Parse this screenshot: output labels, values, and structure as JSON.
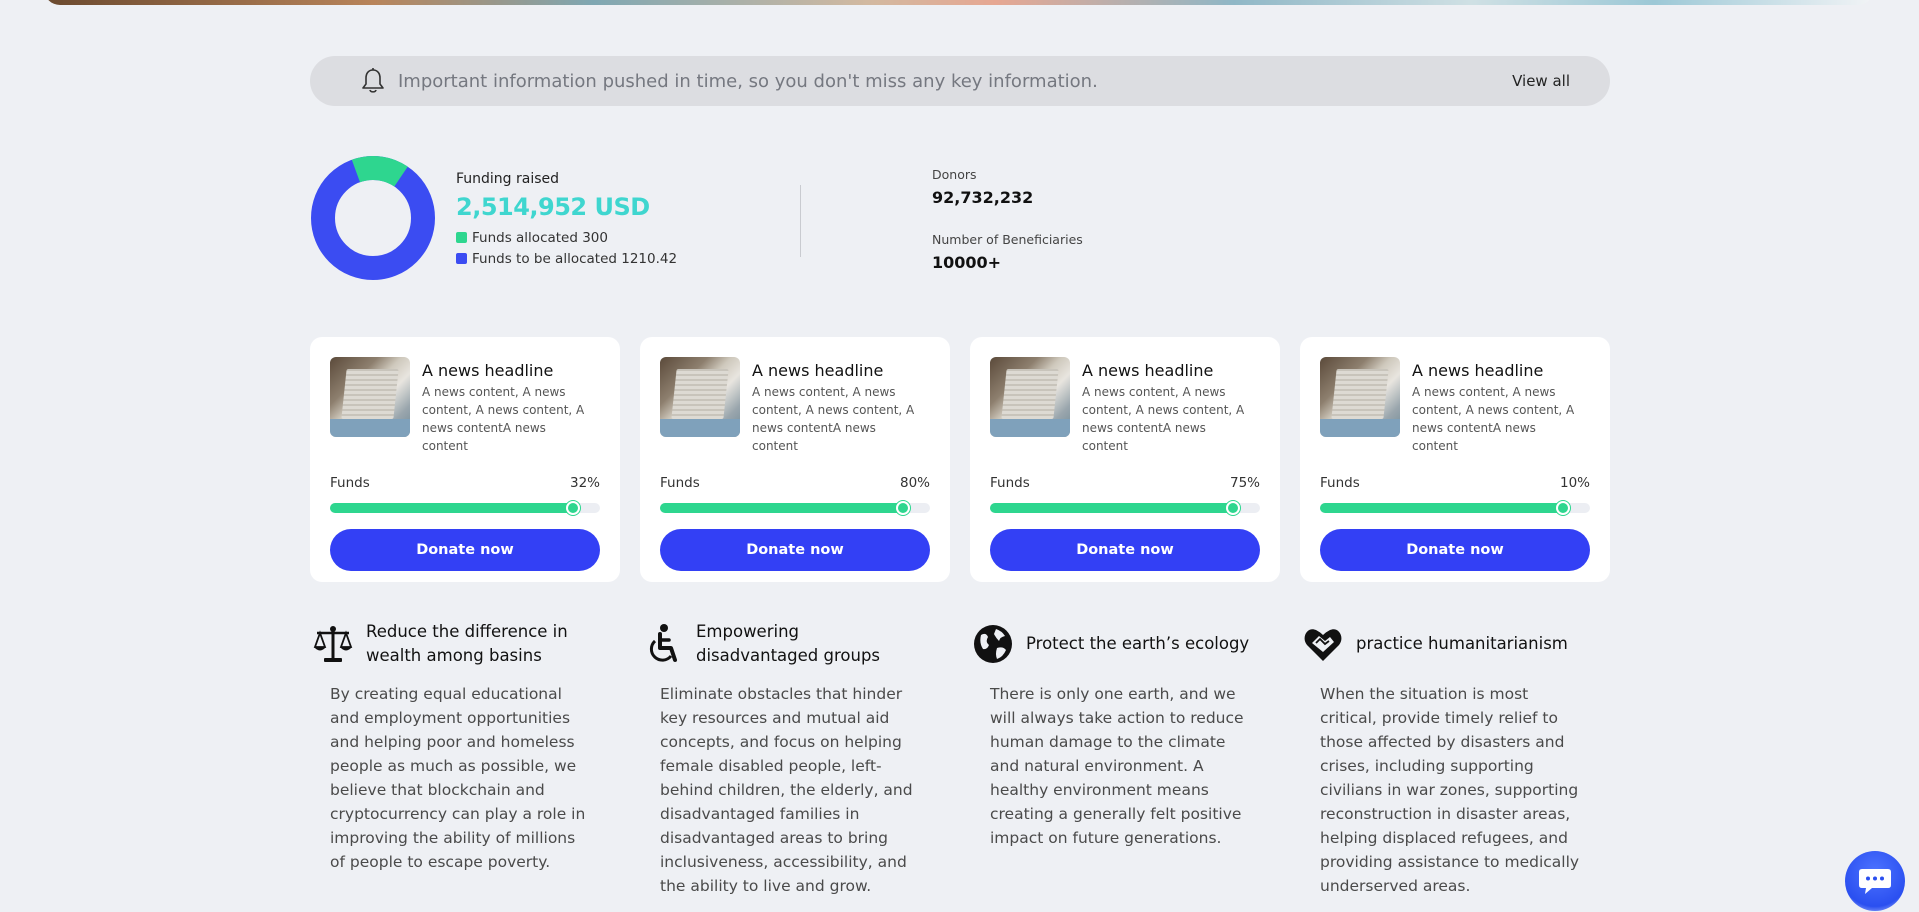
{
  "notice": {
    "message": "Important information pushed in time, so you don't miss any key information.",
    "view_all": "View all"
  },
  "stats": {
    "funding_label": "Funding raised",
    "funding_amount": "2,514,952 USD",
    "legend": [
      {
        "label": "Funds allocated 300",
        "color": "#2ed68f"
      },
      {
        "label": "Funds to be allocated 1210.42",
        "color": "#3b4cf2"
      }
    ],
    "donut_share_allocated": 0.15,
    "donors_label": "Donors",
    "donors_value": "92,732,232",
    "beneficiaries_label": "Number of Beneficiaries",
    "beneficiaries_value": "10000+"
  },
  "cards": [
    {
      "title": "A news headline",
      "body": "A news content, A news content, A news content, A news contentA news content",
      "funds_label": "Funds",
      "percent": "32%",
      "donate": "Donate now"
    },
    {
      "title": "A news headline",
      "body": "A news content, A news content, A news content, A news contentA news content",
      "funds_label": "Funds",
      "percent": "80%",
      "donate": "Donate now"
    },
    {
      "title": "A news headline",
      "body": "A news content, A news content, A news content, A news contentA news content",
      "funds_label": "Funds",
      "percent": "75%",
      "donate": "Donate now"
    },
    {
      "title": "A news headline",
      "body": "A news content, A news content, A news content, A news contentA news content",
      "funds_label": "Funds",
      "percent": "10%",
      "donate": "Donate now"
    }
  ],
  "progress_fill": 0.9,
  "features": [
    {
      "icon": "scales-icon",
      "title": "Reduce the difference in wealth among basins",
      "desc": "By creating equal educational and employment opportunities and helping poor and homeless people as much as possible, we believe that blockchain and cryptocurrency can play a role in improving the ability of millions of people to escape poverty."
    },
    {
      "icon": "wheelchair-icon",
      "title": "Empowering disadvantaged groups",
      "desc": "Eliminate obstacles that hinder key resources and mutual aid concepts, and focus on helping female disabled people, left-behind children, the elderly, and disadvantaged families in disadvantaged areas to bring inclusiveness, accessibility, and the ability to live and grow."
    },
    {
      "icon": "globe-icon",
      "title": "Protect the earth’s ecology",
      "desc": "There is only one earth, and we will always take action to reduce human damage to the climate and natural environment. A healthy environment means creating a generally felt positive impact on future generations."
    },
    {
      "icon": "heart-hands-icon",
      "title": "practice humanitarianism",
      "desc": "When the situation is most critical, provide timely relief to those affected by disasters and crises, including supporting civilians in war zones, supporting reconstruction in disaster areas, helping displaced refugees, and providing assistance to medically underserved areas."
    }
  ]
}
